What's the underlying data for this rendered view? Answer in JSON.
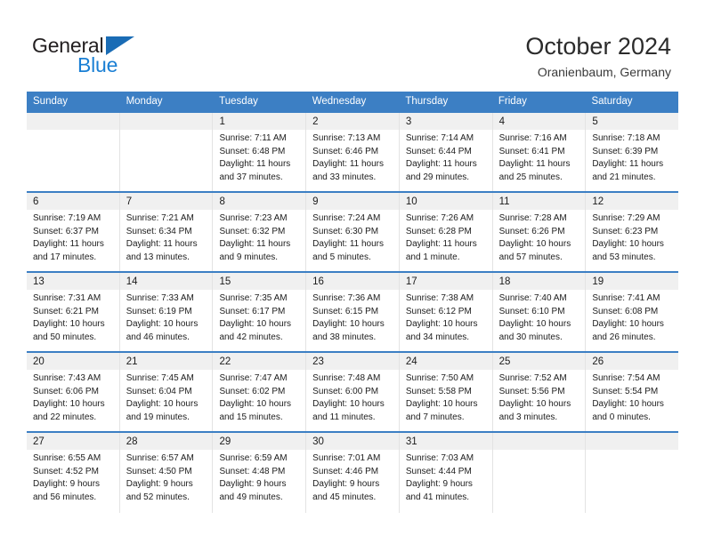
{
  "brand": {
    "name_part1": "General",
    "name_part2": "Blue",
    "triangle_icon": "blue-triangle-logo-mark",
    "color_dark": "#231f20",
    "color_blue": "#1a7fd4"
  },
  "header": {
    "title": "October 2024",
    "subtitle": "Oranienbaum, Germany"
  },
  "theme": {
    "header_bar": "#3c7fc4",
    "daynum_band": "#f0f0f0",
    "cell_border": "#e3e3e3",
    "text": "#1c1c1c"
  },
  "weekdays": [
    {
      "label": "Sunday"
    },
    {
      "label": "Monday"
    },
    {
      "label": "Tuesday"
    },
    {
      "label": "Wednesday"
    },
    {
      "label": "Thursday"
    },
    {
      "label": "Friday"
    },
    {
      "label": "Saturday"
    }
  ],
  "weeks": [
    [
      {
        "day": "",
        "sunrise": "",
        "sunset": "",
        "daylight1": "",
        "daylight2": ""
      },
      {
        "day": "",
        "sunrise": "",
        "sunset": "",
        "daylight1": "",
        "daylight2": ""
      },
      {
        "day": "1",
        "sunrise": "Sunrise: 7:11 AM",
        "sunset": "Sunset: 6:48 PM",
        "daylight1": "Daylight: 11 hours",
        "daylight2": "and 37 minutes."
      },
      {
        "day": "2",
        "sunrise": "Sunrise: 7:13 AM",
        "sunset": "Sunset: 6:46 PM",
        "daylight1": "Daylight: 11 hours",
        "daylight2": "and 33 minutes."
      },
      {
        "day": "3",
        "sunrise": "Sunrise: 7:14 AM",
        "sunset": "Sunset: 6:44 PM",
        "daylight1": "Daylight: 11 hours",
        "daylight2": "and 29 minutes."
      },
      {
        "day": "4",
        "sunrise": "Sunrise: 7:16 AM",
        "sunset": "Sunset: 6:41 PM",
        "daylight1": "Daylight: 11 hours",
        "daylight2": "and 25 minutes."
      },
      {
        "day": "5",
        "sunrise": "Sunrise: 7:18 AM",
        "sunset": "Sunset: 6:39 PM",
        "daylight1": "Daylight: 11 hours",
        "daylight2": "and 21 minutes."
      }
    ],
    [
      {
        "day": "6",
        "sunrise": "Sunrise: 7:19 AM",
        "sunset": "Sunset: 6:37 PM",
        "daylight1": "Daylight: 11 hours",
        "daylight2": "and 17 minutes."
      },
      {
        "day": "7",
        "sunrise": "Sunrise: 7:21 AM",
        "sunset": "Sunset: 6:34 PM",
        "daylight1": "Daylight: 11 hours",
        "daylight2": "and 13 minutes."
      },
      {
        "day": "8",
        "sunrise": "Sunrise: 7:23 AM",
        "sunset": "Sunset: 6:32 PM",
        "daylight1": "Daylight: 11 hours",
        "daylight2": "and 9 minutes."
      },
      {
        "day": "9",
        "sunrise": "Sunrise: 7:24 AM",
        "sunset": "Sunset: 6:30 PM",
        "daylight1": "Daylight: 11 hours",
        "daylight2": "and 5 minutes."
      },
      {
        "day": "10",
        "sunrise": "Sunrise: 7:26 AM",
        "sunset": "Sunset: 6:28 PM",
        "daylight1": "Daylight: 11 hours",
        "daylight2": "and 1 minute."
      },
      {
        "day": "11",
        "sunrise": "Sunrise: 7:28 AM",
        "sunset": "Sunset: 6:26 PM",
        "daylight1": "Daylight: 10 hours",
        "daylight2": "and 57 minutes."
      },
      {
        "day": "12",
        "sunrise": "Sunrise: 7:29 AM",
        "sunset": "Sunset: 6:23 PM",
        "daylight1": "Daylight: 10 hours",
        "daylight2": "and 53 minutes."
      }
    ],
    [
      {
        "day": "13",
        "sunrise": "Sunrise: 7:31 AM",
        "sunset": "Sunset: 6:21 PM",
        "daylight1": "Daylight: 10 hours",
        "daylight2": "and 50 minutes."
      },
      {
        "day": "14",
        "sunrise": "Sunrise: 7:33 AM",
        "sunset": "Sunset: 6:19 PM",
        "daylight1": "Daylight: 10 hours",
        "daylight2": "and 46 minutes."
      },
      {
        "day": "15",
        "sunrise": "Sunrise: 7:35 AM",
        "sunset": "Sunset: 6:17 PM",
        "daylight1": "Daylight: 10 hours",
        "daylight2": "and 42 minutes."
      },
      {
        "day": "16",
        "sunrise": "Sunrise: 7:36 AM",
        "sunset": "Sunset: 6:15 PM",
        "daylight1": "Daylight: 10 hours",
        "daylight2": "and 38 minutes."
      },
      {
        "day": "17",
        "sunrise": "Sunrise: 7:38 AM",
        "sunset": "Sunset: 6:12 PM",
        "daylight1": "Daylight: 10 hours",
        "daylight2": "and 34 minutes."
      },
      {
        "day": "18",
        "sunrise": "Sunrise: 7:40 AM",
        "sunset": "Sunset: 6:10 PM",
        "daylight1": "Daylight: 10 hours",
        "daylight2": "and 30 minutes."
      },
      {
        "day": "19",
        "sunrise": "Sunrise: 7:41 AM",
        "sunset": "Sunset: 6:08 PM",
        "daylight1": "Daylight: 10 hours",
        "daylight2": "and 26 minutes."
      }
    ],
    [
      {
        "day": "20",
        "sunrise": "Sunrise: 7:43 AM",
        "sunset": "Sunset: 6:06 PM",
        "daylight1": "Daylight: 10 hours",
        "daylight2": "and 22 minutes."
      },
      {
        "day": "21",
        "sunrise": "Sunrise: 7:45 AM",
        "sunset": "Sunset: 6:04 PM",
        "daylight1": "Daylight: 10 hours",
        "daylight2": "and 19 minutes."
      },
      {
        "day": "22",
        "sunrise": "Sunrise: 7:47 AM",
        "sunset": "Sunset: 6:02 PM",
        "daylight1": "Daylight: 10 hours",
        "daylight2": "and 15 minutes."
      },
      {
        "day": "23",
        "sunrise": "Sunrise: 7:48 AM",
        "sunset": "Sunset: 6:00 PM",
        "daylight1": "Daylight: 10 hours",
        "daylight2": "and 11 minutes."
      },
      {
        "day": "24",
        "sunrise": "Sunrise: 7:50 AM",
        "sunset": "Sunset: 5:58 PM",
        "daylight1": "Daylight: 10 hours",
        "daylight2": "and 7 minutes."
      },
      {
        "day": "25",
        "sunrise": "Sunrise: 7:52 AM",
        "sunset": "Sunset: 5:56 PM",
        "daylight1": "Daylight: 10 hours",
        "daylight2": "and 3 minutes."
      },
      {
        "day": "26",
        "sunrise": "Sunrise: 7:54 AM",
        "sunset": "Sunset: 5:54 PM",
        "daylight1": "Daylight: 10 hours",
        "daylight2": "and 0 minutes."
      }
    ],
    [
      {
        "day": "27",
        "sunrise": "Sunrise: 6:55 AM",
        "sunset": "Sunset: 4:52 PM",
        "daylight1": "Daylight: 9 hours",
        "daylight2": "and 56 minutes."
      },
      {
        "day": "28",
        "sunrise": "Sunrise: 6:57 AM",
        "sunset": "Sunset: 4:50 PM",
        "daylight1": "Daylight: 9 hours",
        "daylight2": "and 52 minutes."
      },
      {
        "day": "29",
        "sunrise": "Sunrise: 6:59 AM",
        "sunset": "Sunset: 4:48 PM",
        "daylight1": "Daylight: 9 hours",
        "daylight2": "and 49 minutes."
      },
      {
        "day": "30",
        "sunrise": "Sunrise: 7:01 AM",
        "sunset": "Sunset: 4:46 PM",
        "daylight1": "Daylight: 9 hours",
        "daylight2": "and 45 minutes."
      },
      {
        "day": "31",
        "sunrise": "Sunrise: 7:03 AM",
        "sunset": "Sunset: 4:44 PM",
        "daylight1": "Daylight: 9 hours",
        "daylight2": "and 41 minutes."
      },
      {
        "day": "",
        "sunrise": "",
        "sunset": "",
        "daylight1": "",
        "daylight2": ""
      },
      {
        "day": "",
        "sunrise": "",
        "sunset": "",
        "daylight1": "",
        "daylight2": ""
      }
    ]
  ]
}
